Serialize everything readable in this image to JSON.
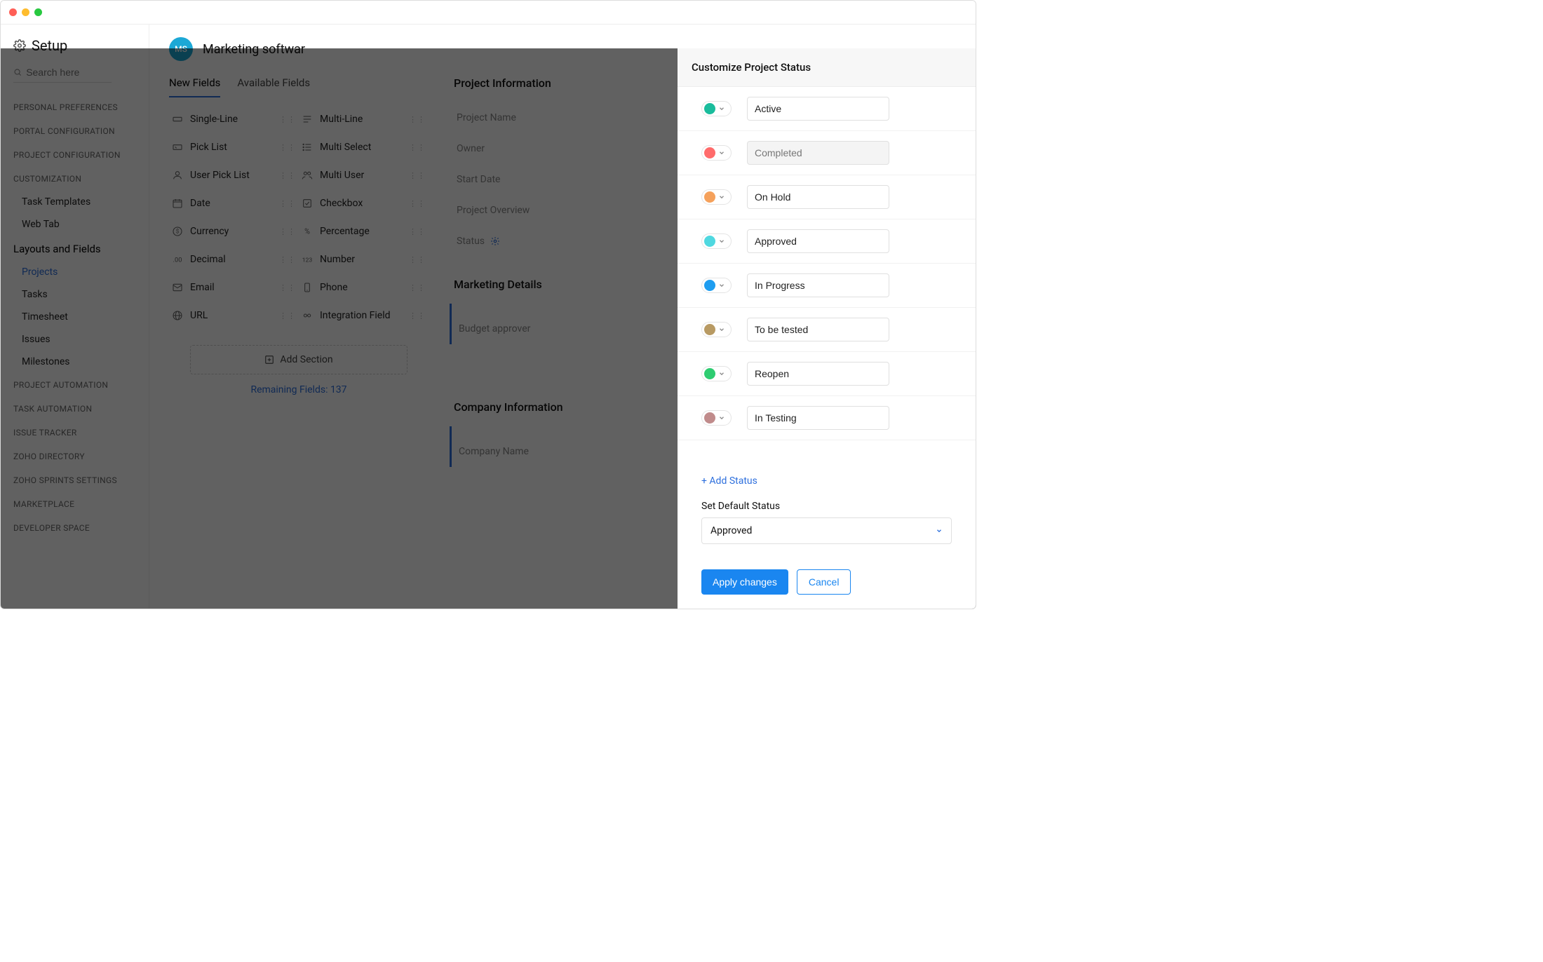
{
  "header": {
    "title": "Setup"
  },
  "search": {
    "placeholder": "Search here"
  },
  "nav": {
    "groups": [
      "PERSONAL PREFERENCES",
      "PORTAL CONFIGURATION",
      "PROJECT CONFIGURATION",
      "CUSTOMIZATION"
    ],
    "customization_items": [
      "Task Templates",
      "Web Tab"
    ],
    "layouts_title": "Layouts and Fields",
    "layouts_items": [
      "Projects",
      "Tasks",
      "Timesheet",
      "Issues",
      "Milestones"
    ],
    "bottom_groups": [
      "PROJECT AUTOMATION",
      "TASK AUTOMATION",
      "ISSUE TRACKER",
      "ZOHO DIRECTORY",
      "ZOHO SPRINTS SETTINGS",
      "MARKETPLACE",
      "DEVELOPER SPACE"
    ]
  },
  "project": {
    "avatar": "MS",
    "name": "Marketing softwar",
    "tabs": [
      "New Fields",
      "Available Fields"
    ]
  },
  "field_types": [
    [
      "Single-Line",
      "Multi-Line"
    ],
    [
      "Pick List",
      "Multi Select"
    ],
    [
      "User Pick List",
      "Multi User"
    ],
    [
      "Date",
      "Checkbox"
    ],
    [
      "Currency",
      "Percentage"
    ],
    [
      "Decimal",
      "Number"
    ],
    [
      "Email",
      "Phone"
    ],
    [
      "URL",
      "Integration Field"
    ]
  ],
  "add_section": "Add Section",
  "remaining": "Remaining Fields: 137",
  "proj_info": {
    "title": "Project Information",
    "fields": [
      "Project Name",
      "Owner",
      "Start Date",
      "Project Overview",
      "Status"
    ]
  },
  "marketing": {
    "title": "Marketing Details",
    "field": "Budget approver"
  },
  "company": {
    "title": "Company Information",
    "field": "Company Name"
  },
  "panel": {
    "title": "Customize Project Status",
    "statuses": [
      {
        "label": "Active",
        "color": "#1abc9c",
        "readonly": false
      },
      {
        "label": "Completed",
        "color": "#ff6b6b",
        "readonly": true
      },
      {
        "label": "On Hold",
        "color": "#f5a15b",
        "readonly": false
      },
      {
        "label": "Approved",
        "color": "#4fd8e0",
        "readonly": false
      },
      {
        "label": "In Progress",
        "color": "#1e9df0",
        "readonly": false
      },
      {
        "label": "To be tested",
        "color": "#b89a63",
        "readonly": false
      },
      {
        "label": "Reopen",
        "color": "#2ecc71",
        "readonly": false
      },
      {
        "label": "In Testing",
        "color": "#c08b8b",
        "readonly": false
      }
    ],
    "add_status": "+ Add Status",
    "default_label": "Set Default Status",
    "default_value": "Approved",
    "apply": "Apply changes",
    "cancel": "Cancel"
  }
}
